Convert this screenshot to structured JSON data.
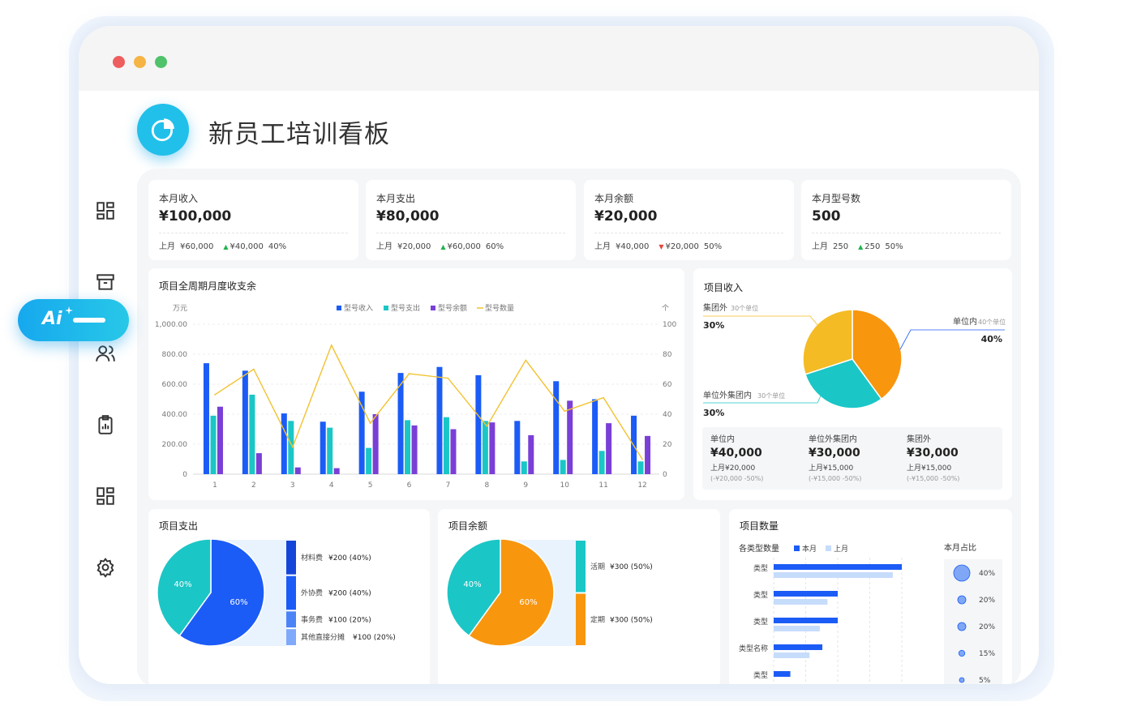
{
  "header": {
    "title": "新员工培训看板"
  },
  "ai_button": {
    "label": "Ai"
  },
  "kpis": [
    {
      "label": "本月收入",
      "value": "¥100,000",
      "prev_label": "上月",
      "prev_value": "¥60,000",
      "delta": "¥40,000",
      "delta_pct": "40%",
      "trend": "up"
    },
    {
      "label": "本月支出",
      "value": "¥80,000",
      "prev_label": "上月",
      "prev_value": "¥20,000",
      "delta": "¥60,000",
      "delta_pct": "60%",
      "trend": "up"
    },
    {
      "label": "本月余额",
      "value": "¥20,000",
      "prev_label": "上月",
      "prev_value": "¥40,000",
      "delta": "¥20,000",
      "delta_pct": "50%",
      "trend": "down"
    },
    {
      "label": "本月型号数",
      "value": "500",
      "prev_label": "上月",
      "prev_value": "250",
      "delta": "250",
      "delta_pct": "50%",
      "trend": "up"
    }
  ],
  "colors": {
    "blue": "#1c5cf6",
    "teal": "#1bc6c6",
    "purple": "#7a3fd6",
    "yellow": "#f2c230",
    "orange": "#f8960e"
  },
  "icons": [
    "dashboard-icon",
    "archive-icon",
    "users-icon",
    "clipboard-chart-icon",
    "apps-icon",
    "gear-icon",
    "pie-chart-icon",
    "sparkle-icon"
  ],
  "sections": {
    "monthly": "项目全周期月度收支余",
    "income": "项目收入",
    "expense": "项目支出",
    "balance": "项目余额",
    "quantity": "项目数量"
  },
  "income_details": [
    {
      "label": "单位内",
      "value": "¥40,000",
      "prev": "上月¥20,000",
      "change": "(-¥20,000 -50%)"
    },
    {
      "label": "单位外集团内",
      "value": "¥30,000",
      "prev": "上月¥15,000",
      "change": "(-¥15,000 -50%)"
    },
    {
      "label": "集团外",
      "value": "¥30,000",
      "prev": "上月¥15,000",
      "change": "(-¥15,000 -50%)"
    }
  ],
  "quantity_labels": {
    "left_title": "各类型数量",
    "right_title": "本月占比"
  },
  "chart_data": [
    {
      "type": "bar",
      "title": "项目全周期月度收支余",
      "ylabel": "万元",
      "y2label": "个",
      "categories": [
        "1",
        "2",
        "3",
        "4",
        "5",
        "6",
        "7",
        "8",
        "9",
        "10",
        "11",
        "12"
      ],
      "ylim": [
        0,
        1000
      ],
      "y2lim": [
        0,
        100
      ],
      "yticks": [
        "0",
        "200.00",
        "400.00",
        "600.00",
        "800.00",
        "1,000.00"
      ],
      "y2ticks": [
        "0",
        "20",
        "40",
        "60",
        "80",
        "100"
      ],
      "legend": "top-center",
      "series": [
        {
          "name": "型号收入",
          "kind": "bar",
          "values": [
            740,
            690,
            405,
            350,
            550,
            675,
            715,
            660,
            355,
            620,
            500,
            390
          ]
        },
        {
          "name": "型号支出",
          "kind": "bar",
          "values": [
            390,
            530,
            355,
            310,
            175,
            360,
            380,
            355,
            85,
            95,
            155,
            85
          ]
        },
        {
          "name": "型号余额",
          "kind": "bar",
          "values": [
            450,
            140,
            45,
            40,
            400,
            325,
            300,
            345,
            260,
            490,
            340,
            255
          ]
        },
        {
          "name": "型号数量",
          "kind": "line",
          "axis": "right",
          "values": [
            53,
            70,
            18,
            86,
            34,
            67,
            64,
            32,
            76,
            42,
            51,
            10
          ]
        }
      ]
    },
    {
      "type": "pie",
      "title": "项目收入",
      "slices": [
        {
          "name": "单位内",
          "sub": "40个单位",
          "value": 40,
          "label": "40%"
        },
        {
          "name": "单位外集团内",
          "sub": "30个单位",
          "value": 30,
          "label": "30%"
        },
        {
          "name": "集团外",
          "sub": "30个单位",
          "value": 30,
          "label": "30%"
        }
      ]
    },
    {
      "type": "pie",
      "title": "项目支出",
      "slices": [
        {
          "value": 60,
          "label": "60%"
        },
        {
          "value": 40,
          "label": "40%"
        }
      ],
      "breakdown": [
        {
          "name": "材料费",
          "value": "¥200 (40%)",
          "pct": 40
        },
        {
          "name": "外协费",
          "value": "¥200 (40%)",
          "pct": 40
        },
        {
          "name": "事务费",
          "value": "¥100 (20%)",
          "pct": 20
        },
        {
          "name": "其他直接分摊",
          "value": "¥100 (20%)",
          "pct": 20
        }
      ]
    },
    {
      "type": "pie",
      "title": "项目余额",
      "slices": [
        {
          "value": 60,
          "label": "60%"
        },
        {
          "value": 40,
          "label": "40%"
        }
      ],
      "breakdown": [
        {
          "name": "活期",
          "value": "¥300 (50%)",
          "pct": 50
        },
        {
          "name": "定期",
          "value": "¥300 (50%)",
          "pct": 50
        }
      ]
    },
    {
      "type": "bar",
      "orientation": "horizontal",
      "title": "各类型数量",
      "categories": [
        "类型",
        "类型",
        "类型",
        "类型名称",
        "类型"
      ],
      "series": [
        {
          "name": "本月",
          "values": [
            100,
            50,
            50,
            38,
            13
          ]
        },
        {
          "name": "上月",
          "values": [
            93,
            42,
            36,
            28,
            0
          ]
        }
      ],
      "share": {
        "title": "本月占比",
        "values": [
          "40%",
          "20%",
          "20%",
          "15%",
          "5%"
        ]
      }
    }
  ]
}
